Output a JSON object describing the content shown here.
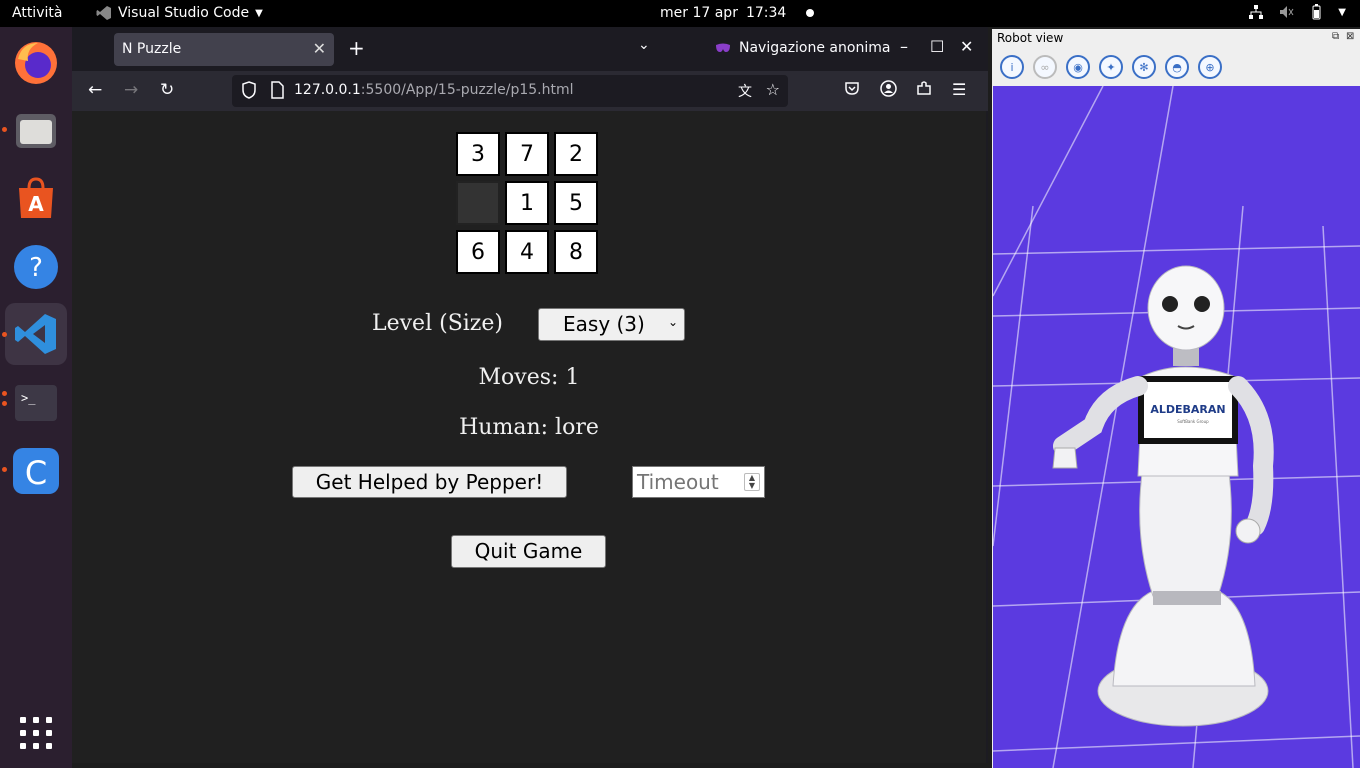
{
  "topbar": {
    "activities": "Attività",
    "app_name": "Visual Studio Code",
    "date": "mer 17 apr",
    "time": "17:34"
  },
  "dock": {
    "items": [
      "firefox",
      "files",
      "ubuntu-software",
      "help",
      "visual-studio-code",
      "terminal",
      "c-app",
      "show-applications"
    ]
  },
  "browser": {
    "tab_title": "N Puzzle",
    "private_label": "Navigazione anonima",
    "url_host": "127.0.0.1",
    "url_rest": ":5500/App/15-puzzle/p15.html"
  },
  "puzzle": {
    "tiles": [
      "3",
      "7",
      "2",
      "",
      "1",
      "5",
      "6",
      "4",
      "8"
    ],
    "level_label": "Level (Size)",
    "level_value": "Easy (3)",
    "moves": "Moves: 1",
    "human": "Human: lore",
    "help_button": "Get Helped by Pepper!",
    "timeout_placeholder": "Timeout",
    "quit_button": "Quit Game"
  },
  "robot_view": {
    "title": "Robot view",
    "logo_text": "ALDEBARAN",
    "logo_subtext": "SoftBank Group"
  }
}
